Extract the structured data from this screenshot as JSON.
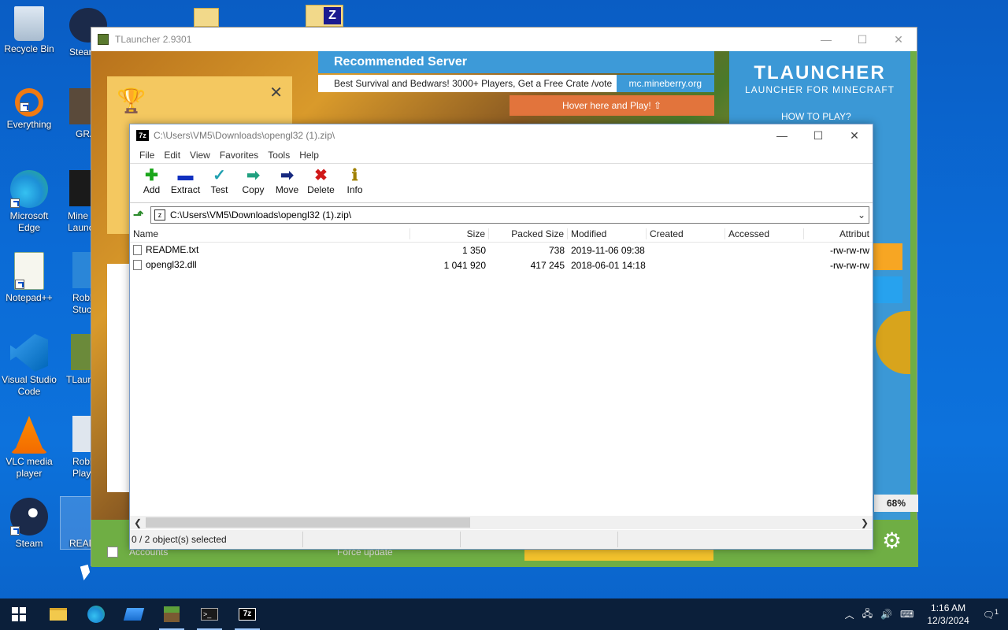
{
  "desktop": {
    "icons": [
      {
        "label": "Recycle Bin",
        "name": "recycle-bin-icon"
      },
      {
        "label": "Everything",
        "name": "everything-icon"
      },
      {
        "label": "Microsoft Edge",
        "name": "edge-icon"
      },
      {
        "label": "Notepad++",
        "name": "notepadpp-icon"
      },
      {
        "label": "Visual Studio Code",
        "name": "vscode-icon"
      },
      {
        "label": "VLC media player",
        "name": "vlc-icon"
      },
      {
        "label": "Steam",
        "name": "steam-icon"
      }
    ],
    "col2_partial": [
      "Stear",
      "GRA",
      "Mine Launc",
      "Robl Stuc",
      "TLaun",
      "Robl Play",
      "READ"
    ]
  },
  "tlauncher": {
    "title": "TLauncher 2.9301",
    "recommended_title": "Recommended Server",
    "server_desc": "Best Survival and Bedwars! 3000+ Players, Get a Free Crate /vote",
    "server_host": "mc.mineberry.org",
    "play_label": "Hover here and Play!",
    "logo": "TLAUNCHER",
    "logo_sub": "LAUNCHER FOR MINECRAFT",
    "howto": "HOW TO PLAY?",
    "progress": "68%",
    "accounts_label": "Accounts",
    "force_update_label": "Force update"
  },
  "sevenzip": {
    "title": "C:\\Users\\VM5\\Downloads\\opengl32 (1).zip\\",
    "menu": [
      "File",
      "Edit",
      "View",
      "Favorites",
      "Tools",
      "Help"
    ],
    "tools": [
      {
        "label": "Add",
        "icon": "add-icon",
        "glyph": "✚",
        "color": "#1aa61a"
      },
      {
        "label": "Extract",
        "icon": "extract-icon",
        "glyph": "▬",
        "color": "#1030c0"
      },
      {
        "label": "Test",
        "icon": "test-icon",
        "glyph": "✓",
        "color": "#20a0b0"
      },
      {
        "label": "Copy",
        "icon": "copy-icon",
        "glyph": "➡",
        "color": "#20a080"
      },
      {
        "label": "Move",
        "icon": "move-icon",
        "glyph": "➡",
        "color": "#182a80"
      },
      {
        "label": "Delete",
        "icon": "delete-icon",
        "glyph": "✖",
        "color": "#d01818"
      },
      {
        "label": "Info",
        "icon": "info-icon",
        "glyph": "ℹ",
        "color": "#a08000"
      }
    ],
    "address": "C:\\Users\\VM5\\Downloads\\opengl32 (1).zip\\",
    "columns": {
      "name": "Name",
      "size": "Size",
      "packed": "Packed Size",
      "modified": "Modified",
      "created": "Created",
      "accessed": "Accessed",
      "attributes": "Attribut"
    },
    "files": [
      {
        "name": "README.txt",
        "size": "1 350",
        "packed": "738",
        "modified": "2019-11-06 09:38",
        "created": "",
        "accessed": "",
        "attributes": "-rw-rw-rw"
      },
      {
        "name": "opengl32.dll",
        "size": "1 041 920",
        "packed": "417 245",
        "modified": "2018-06-01 14:18",
        "created": "",
        "accessed": "",
        "attributes": "-rw-rw-rw"
      }
    ],
    "status": "0 / 2 object(s) selected"
  },
  "taskbar": {
    "time": "1:16 AM",
    "date": "12/3/2024",
    "notif_count": "1"
  }
}
